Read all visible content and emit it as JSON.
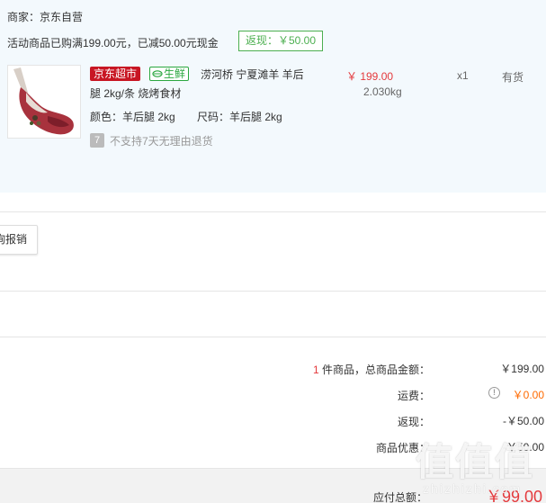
{
  "order": {
    "merchant": "商家：京东自营",
    "promo_text": "活动商品已购满199.00元，已减50.00元现金",
    "rebate_tag": "返现：￥50.00",
    "product": {
      "image_icon": "lamb-leg-product-image",
      "badge_jd": "京东超市",
      "badge_fresh": "生鲜",
      "title_line1": "涝河桥 宁夏滩羊 羊后",
      "title_line2": "腿 2kg/条 烧烤食材",
      "spec_color": "颜色：羊后腿 2kg",
      "spec_size": "尺码：羊后腿 2kg",
      "return_icon": "7",
      "return_policy": "不支持7天无理由退货",
      "price": "￥ 199.00",
      "weight": "2.030kg",
      "quantity": "x1",
      "stock": "有货"
    }
  },
  "reimburse_button": "询报销",
  "summary": {
    "item_count": "1",
    "item_total_label": " 件商品，总商品金额：",
    "item_total_value": "￥199.00",
    "shipping_label": "运费：",
    "shipping_value": "￥0.00",
    "rebate_label": "返现：",
    "rebate_value": "-￥50.00",
    "discount_label": "商品优惠：",
    "discount_value": "-￥50.00",
    "pay_label": "应付总额：",
    "pay_value": "￥99.00"
  },
  "watermark": {
    "glyphs": "值值值",
    "site": "zhizhizhi.com"
  },
  "colors": {
    "accent_red": "#e4393c",
    "jd_red": "#c81623",
    "fresh_green": "#2aa73f",
    "shipping_orange": "#ff6a00",
    "panel_bg": "#f3f9fd"
  }
}
